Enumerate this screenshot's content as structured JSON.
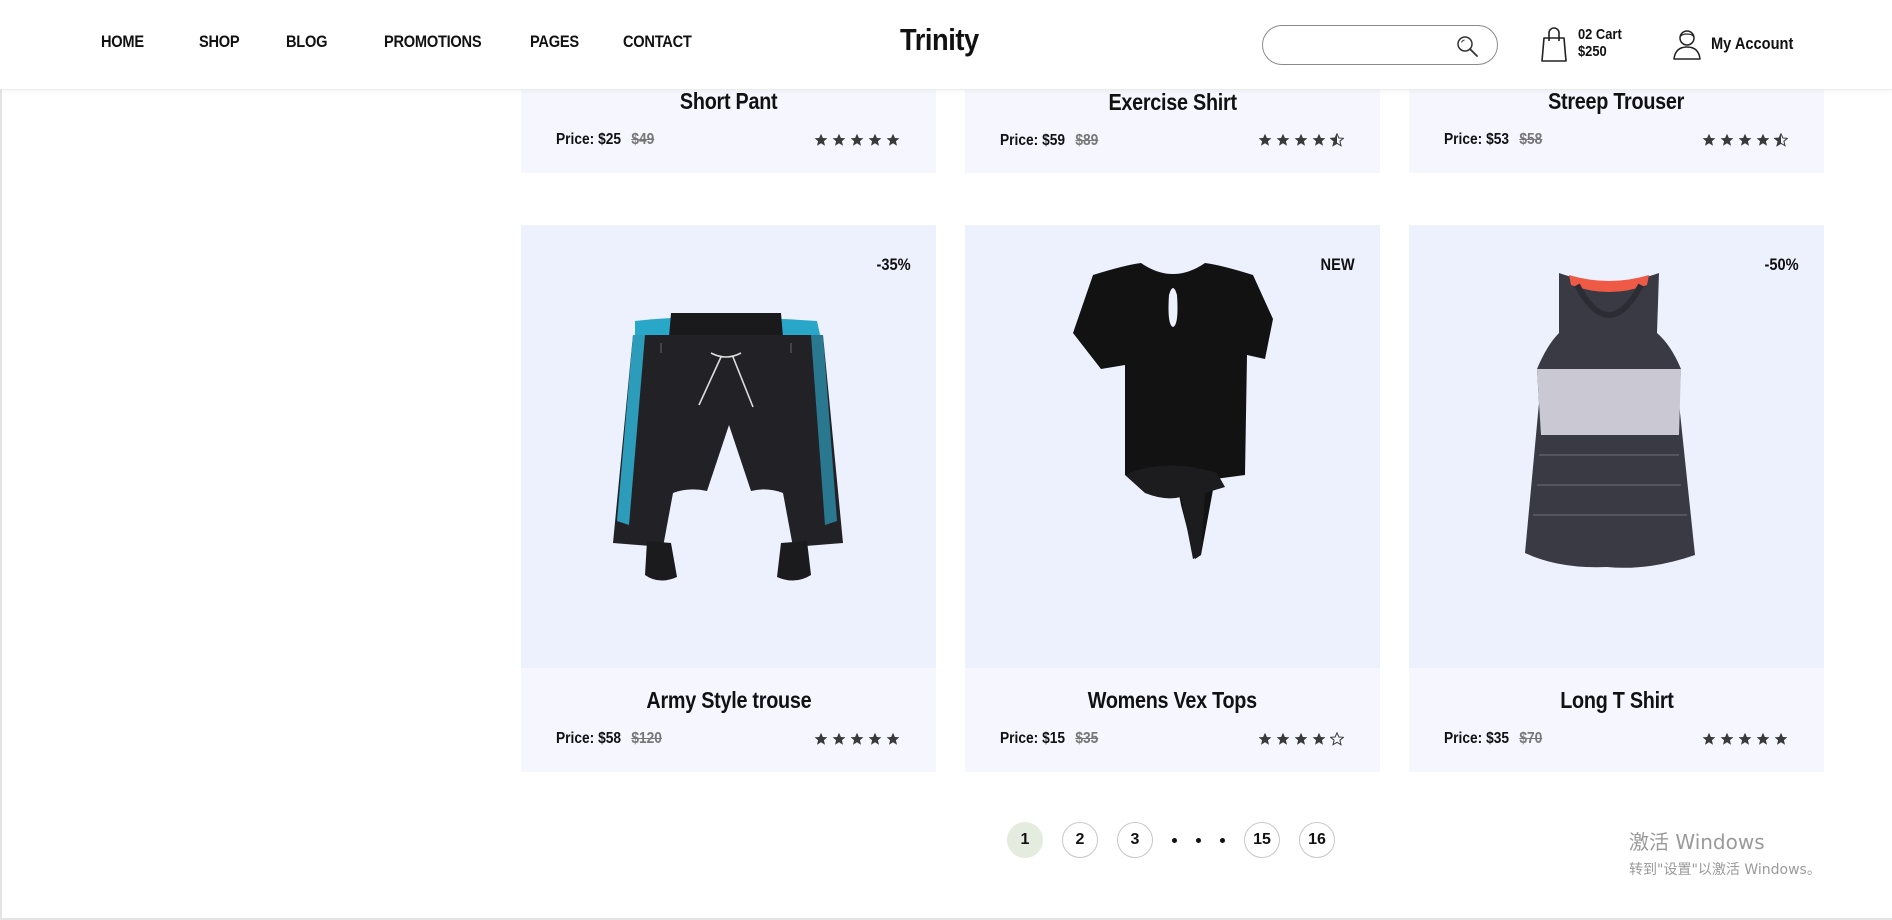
{
  "header": {
    "nav": [
      "HOME",
      "SHOP",
      "BLOG",
      "PROMOTIONS",
      "PAGES",
      "CONTACT"
    ],
    "logo": "Trinity",
    "search": {
      "value": "",
      "placeholder": ""
    },
    "cart": {
      "count_label": "02 Cart",
      "total": "$250"
    },
    "account_label": "My Account"
  },
  "top_row": [
    {
      "name": "Short Pant",
      "price": "Price: $25",
      "old_price": "$49",
      "rating": 5
    },
    {
      "name": "Exercise Shirt",
      "price": "Price: $59",
      "old_price": "$89",
      "rating": 4.5
    },
    {
      "name": "Streep Trouser",
      "price": "Price: $53",
      "old_price": "$58",
      "rating": 4.5
    }
  ],
  "products": [
    {
      "name": "Army Style trouse",
      "price": "Price: $58",
      "old_price": "$120",
      "badge": "-35%",
      "rating": 5,
      "image_icon": "shorts-icon"
    },
    {
      "name": "Womens Vex Tops",
      "price": "Price: $15",
      "old_price": "$35",
      "badge": "NEW",
      "rating": 4,
      "image_icon": "tie-top-icon"
    },
    {
      "name": "Long T Shirt",
      "price": "Price: $35",
      "old_price": "$70",
      "badge": "-50%",
      "rating": 5,
      "image_icon": "tank-top-icon"
    }
  ],
  "pagination": {
    "pages": [
      "1",
      "2",
      "3",
      "15",
      "16"
    ],
    "active": "1"
  },
  "watermark": {
    "title": "激活 Windows",
    "subtitle": "转到\"设置\"以激活 Windows。"
  },
  "colors": {
    "card_image_bg": "#edf0fd",
    "card_info_bg": "#f6f7fe",
    "active_page_bg": "#e3ecdf"
  }
}
